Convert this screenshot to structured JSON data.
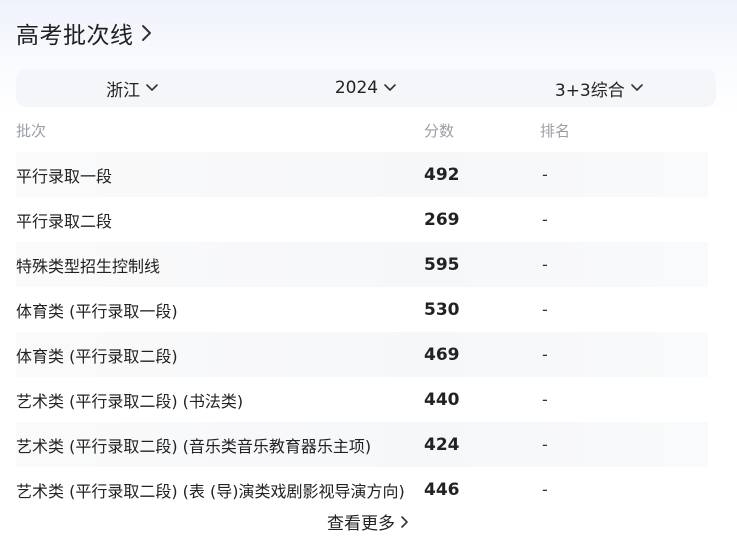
{
  "header": {
    "title": "高考批次线",
    "icon": "chevron-right-icon"
  },
  "filters": {
    "province": "浙江",
    "year": "2024",
    "subject": "3+3综合"
  },
  "table": {
    "columns": [
      "批次",
      "分数",
      "排名"
    ],
    "rows": [
      {
        "batch": "平行录取一段",
        "score": "492",
        "rank": "-"
      },
      {
        "batch": "平行录取二段",
        "score": "269",
        "rank": "-"
      },
      {
        "batch": "特殊类型招生控制线",
        "score": "595",
        "rank": "-"
      },
      {
        "batch": "体育类 (平行录取一段)",
        "score": "530",
        "rank": "-"
      },
      {
        "batch": "体育类 (平行录取二段)",
        "score": "469",
        "rank": "-"
      },
      {
        "batch": "艺术类 (平行录取二段) (书法类)",
        "score": "440",
        "rank": "-"
      },
      {
        "batch": "艺术类 (平行录取二段) (音乐类音乐教育器乐主项)",
        "score": "424",
        "rank": "-"
      },
      {
        "batch": "艺术类 (平行录取二段) (表 (导)演类戏剧影视导演方向)",
        "score": "446",
        "rank": "-"
      }
    ]
  },
  "more": {
    "label": "查看更多"
  }
}
